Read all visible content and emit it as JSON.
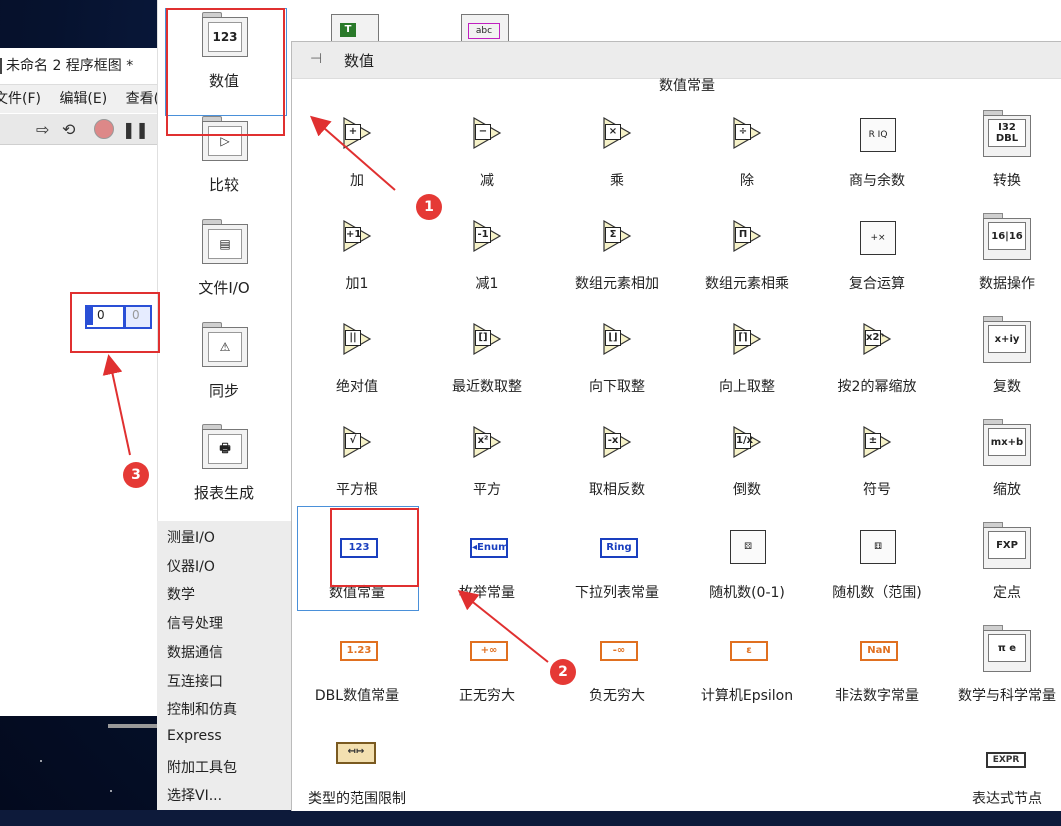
{
  "window": {
    "title": "未命名 2 程序框图 *",
    "menu": [
      "文件(F)",
      "编辑(E)",
      "查看(V)"
    ]
  },
  "categories": {
    "icon_items": [
      {
        "label": "数值",
        "icon": "numeric-icon",
        "glyph": "123"
      },
      {
        "label": "比较",
        "icon": "comparison-icon",
        "glyph": "▷"
      },
      {
        "label": "文件I/O",
        "icon": "file-io-icon",
        "glyph": "▤"
      },
      {
        "label": "同步",
        "icon": "sync-icon",
        "glyph": "⚠"
      },
      {
        "label": "报表生成",
        "icon": "report-icon",
        "glyph": "🖶"
      }
    ],
    "text_items": [
      "测量I/O",
      "仪器I/O",
      "数学",
      "信号处理",
      "数据通信",
      "互连接口",
      "控制和仿真",
      "Express",
      "附加工具包",
      "选择VI..."
    ]
  },
  "palette": {
    "title": "数值",
    "subtitle": "数值常量",
    "rows": [
      [
        {
          "label": "加",
          "kind": "tri",
          "sym": "+"
        },
        {
          "label": "减",
          "kind": "tri",
          "sym": "−"
        },
        {
          "label": "乘",
          "kind": "tri",
          "sym": "×"
        },
        {
          "label": "除",
          "kind": "tri",
          "sym": "÷"
        },
        {
          "label": "商与余数",
          "kind": "box",
          "sym": "R IQ"
        },
        {
          "label": "转换",
          "kind": "folder",
          "sym": "I32 DBL"
        }
      ],
      [
        {
          "label": "加1",
          "kind": "tri",
          "sym": "+1"
        },
        {
          "label": "减1",
          "kind": "tri",
          "sym": "-1"
        },
        {
          "label": "数组元素相加",
          "kind": "tri",
          "sym": "Σ"
        },
        {
          "label": "数组元素相乘",
          "kind": "tri",
          "sym": "Π"
        },
        {
          "label": "复合运算",
          "kind": "box",
          "sym": "+×"
        },
        {
          "label": "数据操作",
          "kind": "folder",
          "sym": "16|16"
        }
      ],
      [
        {
          "label": "绝对值",
          "kind": "tri",
          "sym": "||"
        },
        {
          "label": "最近数取整",
          "kind": "tri",
          "sym": "[]"
        },
        {
          "label": "向下取整",
          "kind": "tri",
          "sym": "⌊⌋"
        },
        {
          "label": "向上取整",
          "kind": "tri",
          "sym": "⌈⌉"
        },
        {
          "label": "按2的幂缩放",
          "kind": "tri",
          "sym": "x2ⁿ"
        },
        {
          "label": "复数",
          "kind": "folder",
          "sym": "x+iy"
        }
      ],
      [
        {
          "label": "平方根",
          "kind": "tri",
          "sym": "√"
        },
        {
          "label": "平方",
          "kind": "tri",
          "sym": "x²"
        },
        {
          "label": "取相反数",
          "kind": "tri",
          "sym": "-x"
        },
        {
          "label": "倒数",
          "kind": "tri",
          "sym": "1/x"
        },
        {
          "label": "符号",
          "kind": "tri",
          "sym": "±"
        },
        {
          "label": "缩放",
          "kind": "folder",
          "sym": "mx+b"
        }
      ],
      [
        {
          "label": "数值常量",
          "kind": "const",
          "sym": "123",
          "color": "#1a3fbf"
        },
        {
          "label": "枚举常量",
          "kind": "const",
          "sym": "◂Enum",
          "color": "#1a3fbf"
        },
        {
          "label": "下拉列表常量",
          "kind": "const",
          "sym": "Ring",
          "color": "#1a3fbf"
        },
        {
          "label": "随机数(0-1)",
          "kind": "box",
          "sym": "⚄"
        },
        {
          "label": "随机数（范围)",
          "kind": "box",
          "sym": "⚅"
        },
        {
          "label": "定点",
          "kind": "folder",
          "sym": "FXP"
        }
      ],
      [
        {
          "label": "DBL数值常量",
          "kind": "const",
          "sym": "1.23",
          "color": "#e07020"
        },
        {
          "label": "正无穷大",
          "kind": "const",
          "sym": "+∞",
          "color": "#e07020"
        },
        {
          "label": "负无穷大",
          "kind": "const",
          "sym": "-∞",
          "color": "#e07020"
        },
        {
          "label": "计算机Epsilon",
          "kind": "const",
          "sym": "ε",
          "color": "#e07020"
        },
        {
          "label": "非法数字常量",
          "kind": "const",
          "sym": "NaN",
          "color": "#e07020"
        },
        {
          "label": "数学与科学常量",
          "kind": "folder",
          "sym": "π e"
        }
      ],
      [
        {
          "label": "类型的范围限制",
          "kind": "range",
          "sym": "↤↦"
        },
        {
          "label": "",
          "kind": "none",
          "sym": ""
        },
        {
          "label": "",
          "kind": "none",
          "sym": ""
        },
        {
          "label": "",
          "kind": "none",
          "sym": ""
        },
        {
          "label": "",
          "kind": "none",
          "sym": ""
        },
        {
          "label": "表达式节点",
          "kind": "expr",
          "sym": "EXPR"
        }
      ]
    ]
  },
  "diagram": {
    "control_value": "0",
    "indicator_value": "0"
  },
  "top_partial_icons": [
    {
      "icon": "string-constant-icon",
      "glyph": "T"
    },
    {
      "icon": "string-icon",
      "glyph": "abc"
    }
  ],
  "annotations": [
    "1",
    "2",
    "3"
  ]
}
